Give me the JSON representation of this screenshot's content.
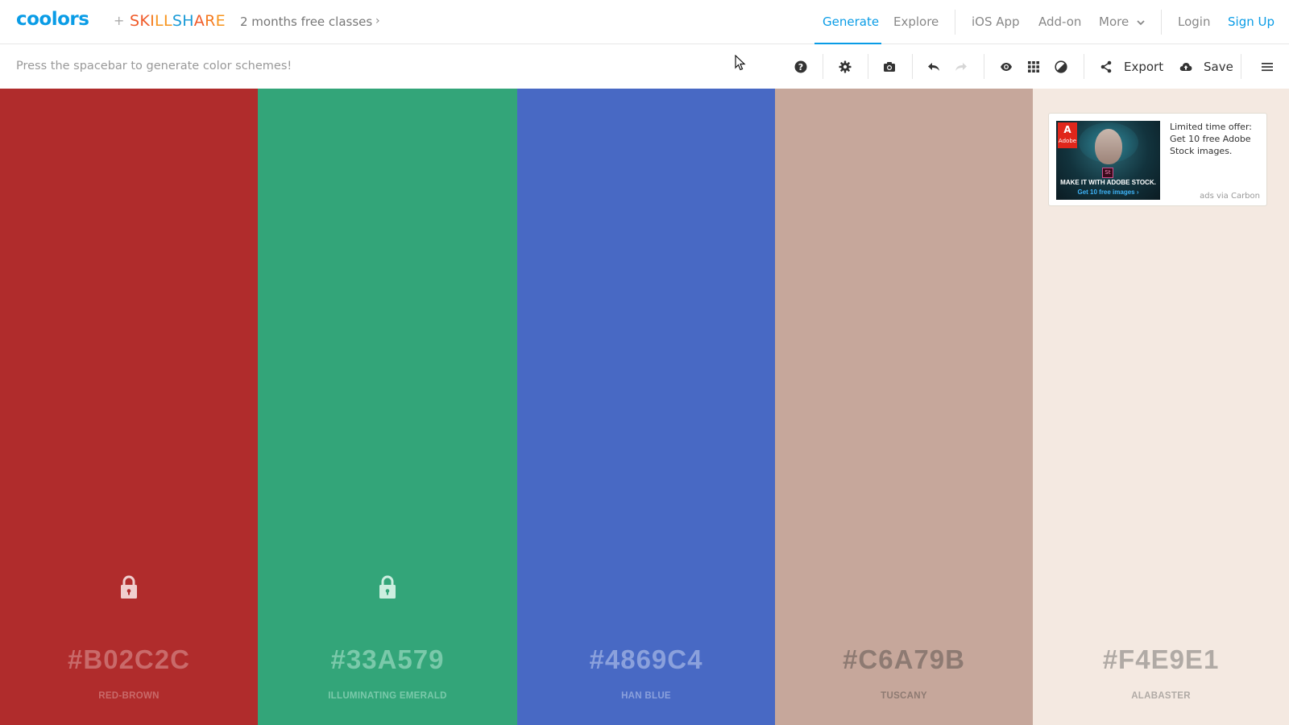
{
  "header": {
    "logo": "coolors",
    "plus": "+",
    "partner_letters": [
      {
        "ch": "S",
        "color": "#f05a28"
      },
      {
        "ch": "K",
        "color": "#f05a28"
      },
      {
        "ch": "I",
        "color": "#f47a20"
      },
      {
        "ch": "L",
        "color": "#f7941d"
      },
      {
        "ch": "L",
        "color": "#f7941d"
      },
      {
        "ch": "S",
        "color": "#1b9bd7"
      },
      {
        "ch": "H",
        "color": "#1b9bd7"
      },
      {
        "ch": "A",
        "color": "#f05a28"
      },
      {
        "ch": "R",
        "color": "#f47a20"
      },
      {
        "ch": "E",
        "color": "#f7941d"
      }
    ],
    "promo": "2 months free classes",
    "promo_chevron": "›",
    "nav": {
      "generate": "Generate",
      "explore": "Explore",
      "ios_app": "iOS App",
      "addon": "Add-on",
      "more": "More",
      "login": "Login",
      "signup": "Sign Up"
    }
  },
  "toolbar": {
    "hint": "Press the spacebar to generate color schemes!",
    "export_label": "Export",
    "save_label": "Save",
    "icons": [
      "help-icon",
      "gear-icon",
      "camera-icon",
      "undo-icon",
      "redo-icon",
      "eye-icon",
      "grid-icon",
      "contrast-icon",
      "share-icon",
      "cloud-upload-icon",
      "menu-icon"
    ]
  },
  "palette": [
    {
      "hex": "#B02C2C",
      "name": "RED-BROWN",
      "bg": "#b02c2c",
      "text_color": "#c96a6a",
      "locked": true,
      "lock_color": "#f0cfcf"
    },
    {
      "hex": "#33A579",
      "name": "ILLUMINATING EMERALD",
      "bg": "#33a579",
      "text_color": "#7ac9aa",
      "locked": true,
      "lock_color": "#cdeee0"
    },
    {
      "hex": "#4869C4",
      "name": "HAN BLUE",
      "bg": "#4869c4",
      "text_color": "#8ba1dc",
      "locked": false
    },
    {
      "hex": "#C6A79B",
      "name": "TUSCANY",
      "bg": "#c6a79b",
      "text_color": "#8d7a72",
      "locked": false
    },
    {
      "hex": "#F4E9E1",
      "name": "ALABASTER",
      "bg": "#f4e9e1",
      "text_color": "#b0aaa5",
      "locked": false
    }
  ],
  "ad": {
    "headline": "Limited time offer: Get 10 free Adobe Stock images.",
    "via": "ads via Carbon",
    "brand": "Adobe",
    "badge": "St",
    "caption1": "MAKE IT WITH ADOBE STOCK.",
    "caption2": "Get 10 free images ›"
  }
}
